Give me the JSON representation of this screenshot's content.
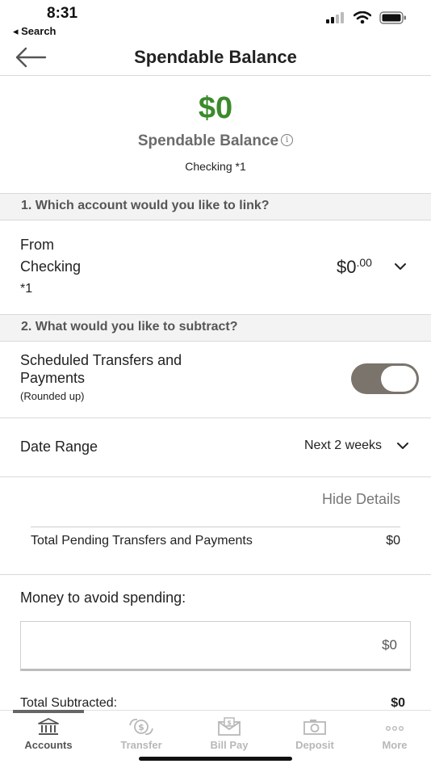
{
  "status": {
    "time": "8:31",
    "back_label": "◂ Search",
    "icons": [
      "cellular-signal-icon",
      "wifi-icon",
      "battery-icon"
    ]
  },
  "header": {
    "title": "Spendable Balance"
  },
  "balance": {
    "amount": "$0",
    "label": "Spendable Balance",
    "account": "Checking *1",
    "amount_color": "#3b8a2c"
  },
  "section1": {
    "title": "1. Which account would you like to link?",
    "from_label": "From",
    "account_name": "Checking",
    "account_mask": "*1",
    "amount_main": "$0",
    "amount_cents": ".00"
  },
  "section2": {
    "title": "2. What would you like to subtract?",
    "scheduled_label_line1": "Scheduled Transfers and",
    "scheduled_label_line2": "Payments",
    "scheduled_note": "(Rounded up)",
    "scheduled_toggle_on": true,
    "date_range_label": "Date Range",
    "date_range_value": "Next 2 weeks",
    "hide_details": "Hide Details",
    "pending_label": "Total Pending Transfers and Payments",
    "pending_value": "$0",
    "money_avoid_label": "Money to avoid spending:",
    "money_avoid_value": "$0",
    "total_subtracted_label": "Total Subtracted:",
    "total_subtracted_value": "$0"
  },
  "tabbar": {
    "tabs": [
      {
        "label": "Accounts",
        "icon": "bank-icon",
        "active": true
      },
      {
        "label": "Transfer",
        "icon": "transfer-icon",
        "active": false
      },
      {
        "label": "Bill Pay",
        "icon": "bill-pay-icon",
        "active": false
      },
      {
        "label": "Deposit",
        "icon": "camera-icon",
        "active": false
      },
      {
        "label": "More",
        "icon": "more-dots-icon",
        "active": false
      }
    ]
  }
}
